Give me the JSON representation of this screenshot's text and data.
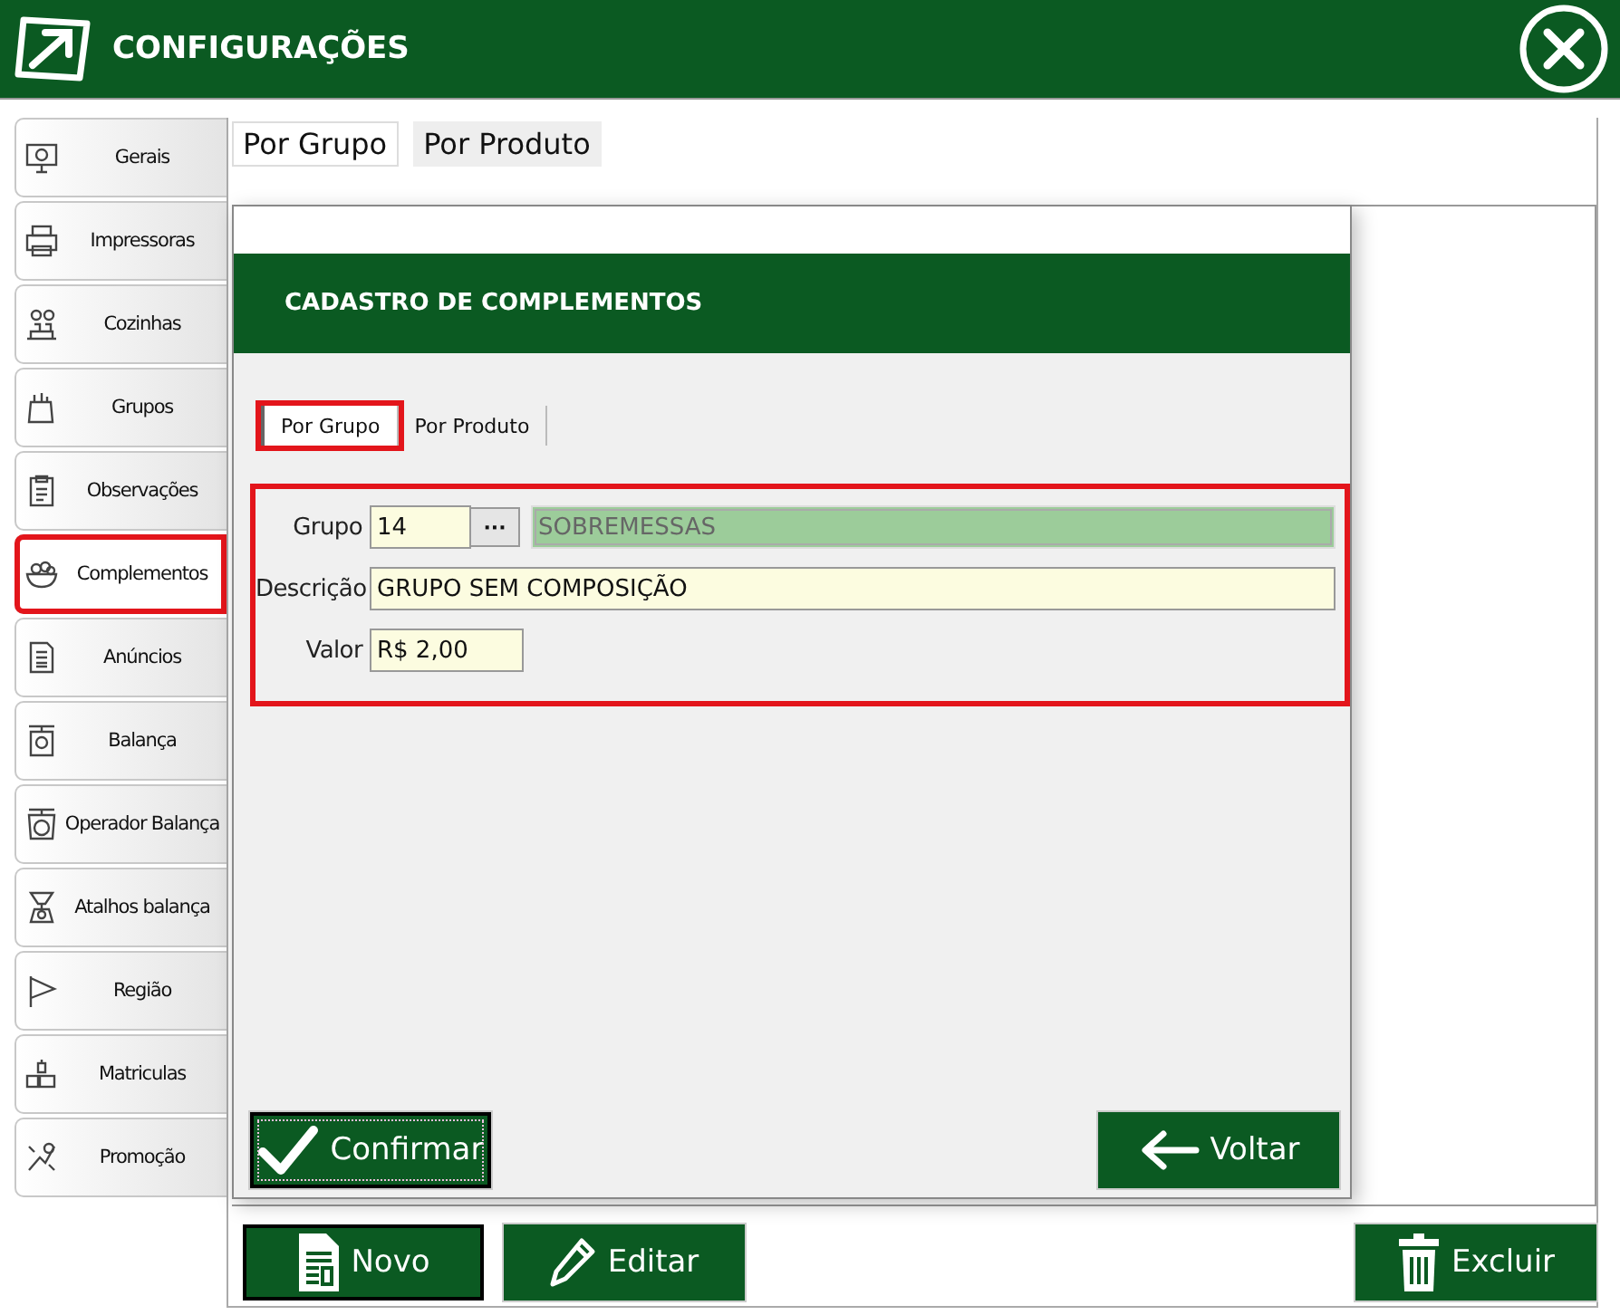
{
  "window": {
    "title": "CONFIGURAÇÕES"
  },
  "sidebar": {
    "items": [
      {
        "label": "Gerais",
        "selected": false,
        "highlighted": false
      },
      {
        "label": "Impressoras",
        "selected": false,
        "highlighted": false
      },
      {
        "label": "Cozinhas",
        "selected": false,
        "highlighted": false
      },
      {
        "label": "Grupos",
        "selected": false,
        "highlighted": false
      },
      {
        "label": "Observações",
        "selected": false,
        "highlighted": false
      },
      {
        "label": "Complementos",
        "selected": true,
        "highlighted": true
      },
      {
        "label": "Anúncios",
        "selected": false,
        "highlighted": false
      },
      {
        "label": "Balança",
        "selected": false,
        "highlighted": false
      },
      {
        "label": "Operador  Balança",
        "selected": false,
        "highlighted": false
      },
      {
        "label": "Atalhos balança",
        "selected": false,
        "highlighted": false
      },
      {
        "label": "Região",
        "selected": false,
        "highlighted": false
      },
      {
        "label": "Matriculas",
        "selected": false,
        "highlighted": false
      },
      {
        "label": "Promoção",
        "selected": false,
        "highlighted": false
      }
    ]
  },
  "tabs": [
    {
      "label": "Por Grupo",
      "selected": true
    },
    {
      "label": "Por Produto",
      "selected": false
    }
  ],
  "dialog": {
    "title": "CADASTRO DE COMPLEMENTOS",
    "tabs": [
      {
        "label": "Por Grupo",
        "selected": true,
        "highlighted": true
      },
      {
        "label": "Por Produto",
        "selected": false,
        "highlighted": false
      }
    ],
    "form": {
      "highlighted": true,
      "grupo": {
        "label": "Grupo",
        "value": "14",
        "lookup": "···",
        "name": "SOBREMESSAS"
      },
      "descricao": {
        "label": "Descrição",
        "value": "GRUPO SEM COMPOSIÇÃO"
      },
      "valor": {
        "label": "Valor",
        "value": "R$ 2,00"
      }
    },
    "buttons": [
      {
        "label": "Confirmar",
        "kind": "check",
        "focused": true
      },
      {
        "label": "Voltar",
        "kind": "back",
        "focused": false
      }
    ]
  },
  "buttons": [
    {
      "label": "Novo",
      "kind": "new",
      "focused": true
    },
    {
      "label": "Editar",
      "kind": "edit",
      "focused": false
    },
    {
      "label": "Excluir",
      "kind": "delete",
      "focused": false
    }
  ]
}
